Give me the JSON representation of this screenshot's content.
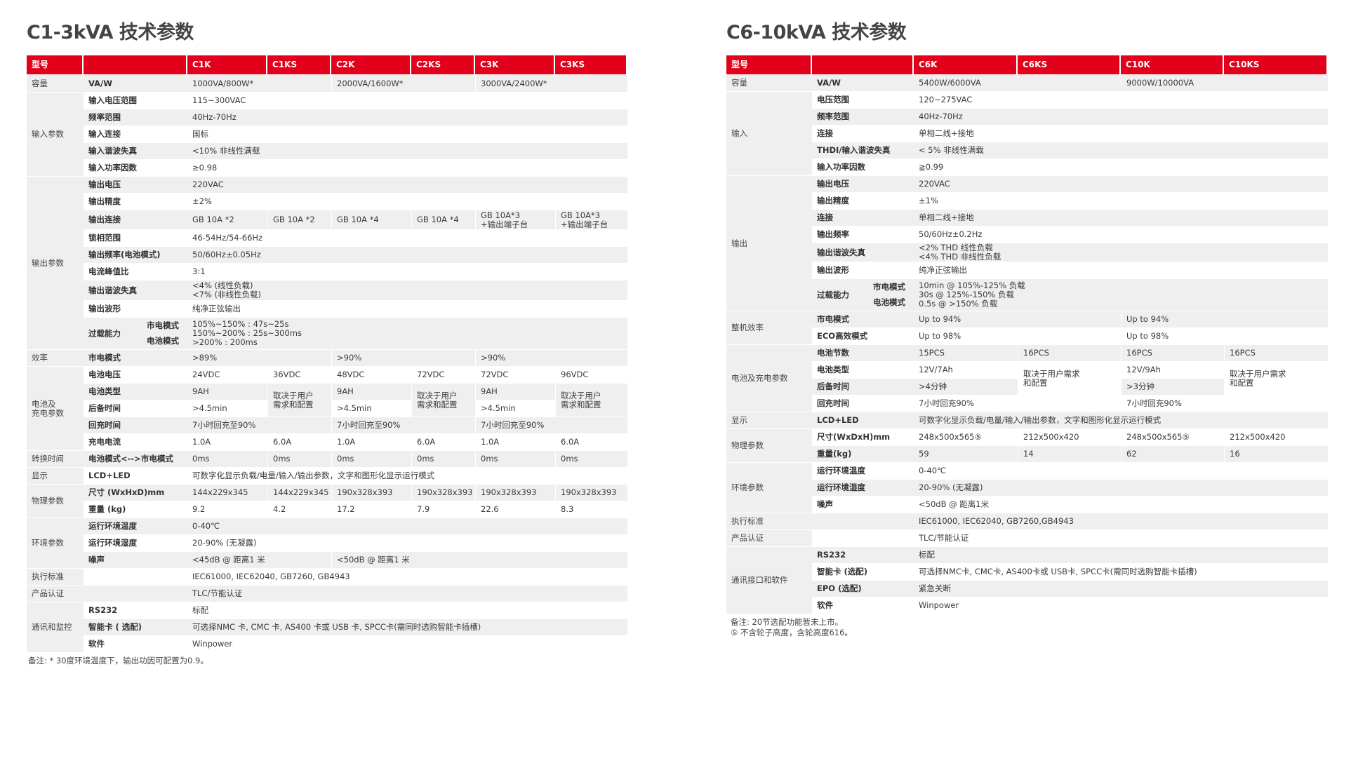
{
  "left": {
    "title": "C1-3kVA 技术参数",
    "header": [
      "型号",
      "",
      "C1K",
      "C1KS",
      "C2K",
      "C2KS",
      "C3K",
      "C3KS"
    ],
    "rows": [
      {
        "h": 24,
        "cat": "容量",
        "cat_span": 1,
        "param": "VA/W",
        "vals": [
          {
            "t": "1000VA/800W*",
            "s": 2
          },
          {
            "t": "2000VA/1600W*",
            "s": 2
          },
          {
            "t": "3000VA/2400W*",
            "s": 2
          }
        ]
      },
      {
        "h": 23,
        "cat": "输入参数",
        "cat_span": 5,
        "param": "输入电压范围",
        "vals": [
          {
            "t": "115~300VAC",
            "s": 6
          }
        ]
      },
      {
        "h": 23,
        "param": "频率范围",
        "vals": [
          {
            "t": "40Hz-70Hz",
            "s": 6
          }
        ]
      },
      {
        "h": 23,
        "param": "输入连接",
        "vals": [
          {
            "t": "国标",
            "s": 6
          }
        ]
      },
      {
        "h": 23,
        "param": "输入谐波失真",
        "vals": [
          {
            "t": "<10% 非线性满载",
            "s": 6
          }
        ]
      },
      {
        "h": 23,
        "param": "输入功率因数",
        "vals": [
          {
            "t": "≥0.98",
            "s": 6
          }
        ]
      },
      {
        "h": 23,
        "cat": "输出参数",
        "cat_span": 10,
        "param": "输出电压",
        "vals": [
          {
            "t": "220VAC",
            "s": 6
          }
        ]
      },
      {
        "h": 23,
        "param": "输出精度",
        "vals": [
          {
            "t": "±2%",
            "s": 6
          }
        ]
      },
      {
        "h": 27,
        "param": "输出连接",
        "vals": [
          {
            "t": "GB 10A *2",
            "s": 1
          },
          {
            "t": "GB 10A *2",
            "s": 1
          },
          {
            "t": "GB 10A *4",
            "s": 1
          },
          {
            "t": "GB 10A *4",
            "s": 1
          },
          {
            "t": "GB 10A*3\n+输出端子台",
            "s": 1
          },
          {
            "t": "GB 10A*3\n+输出端子台",
            "s": 1
          }
        ]
      },
      {
        "h": 23,
        "param": "锁相范围",
        "vals": [
          {
            "t": "46-54Hz/54-66Hz",
            "s": 6
          }
        ]
      },
      {
        "h": 23,
        "param": "输出频率(电池模式)",
        "vals": [
          {
            "t": "50/60Hz±0.05Hz",
            "s": 6
          }
        ]
      },
      {
        "h": 23,
        "param": "电流峰值比",
        "vals": [
          {
            "t": "3:1",
            "s": 6
          }
        ]
      },
      {
        "h": 28,
        "param": "输出谐波失真",
        "vals": [
          {
            "t": "<4% (线性负载)\n<7% (非线性负载)",
            "s": 6
          }
        ]
      },
      {
        "h": 23,
        "param": "输出波形",
        "vals": [
          {
            "t": "纯净正弦输出",
            "s": 6
          }
        ]
      },
      {
        "h": 22,
        "param": "过载能力",
        "param_span": 2,
        "sub": "市电模式",
        "vals": [
          {
            "t": "105%~150% : 47s~25s\n150%~200% : 25s~300ms\n>200% : 200ms",
            "s": 6,
            "r": 2
          }
        ]
      },
      {
        "h": 22,
        "sub": "电池模式",
        "vals": []
      },
      {
        "h": 23,
        "cat": "效率",
        "cat_span": 1,
        "param": "市电模式",
        "vals": [
          {
            "t": ">89%",
            "s": 2
          },
          {
            "t": ">90%",
            "s": 2
          },
          {
            "t": ">90%",
            "s": 2
          }
        ]
      },
      {
        "h": 23,
        "cat": "电池及\n充电参数",
        "cat_span": 5,
        "param": "电池电压",
        "vals": [
          {
            "t": "24VDC",
            "s": 1
          },
          {
            "t": "36VDC",
            "s": 1
          },
          {
            "t": "48VDC",
            "s": 1
          },
          {
            "t": "72VDC",
            "s": 1
          },
          {
            "t": "72VDC",
            "s": 1
          },
          {
            "t": "96VDC",
            "s": 1
          }
        ]
      },
      {
        "h": 23,
        "param": "电池类型",
        "vals": [
          {
            "t": "9AH",
            "s": 1
          },
          {
            "t": "取决于用户\n需求和配置",
            "s": 1,
            "r": 2
          },
          {
            "t": "9AH",
            "s": 1
          },
          {
            "t": "取决于用户\n需求和配置",
            "s": 1,
            "r": 2
          },
          {
            "t": "9AH",
            "s": 1
          },
          {
            "t": "取决于用户\n需求和配置",
            "s": 1,
            "r": 2
          }
        ]
      },
      {
        "h": 23,
        "param": "后备时间",
        "vals": [
          {
            "t": ">4.5min",
            "s": 1
          },
          {
            "t": ">4.5min",
            "s": 1
          },
          {
            "t": ">4.5min",
            "s": 1
          }
        ]
      },
      {
        "h": 23,
        "param": "回充时间",
        "vals": [
          {
            "t": "7小时回充至90%",
            "s": 2
          },
          {
            "t": "7小时回充至90%",
            "s": 2
          },
          {
            "t": "7小时回充至90%",
            "s": 2
          }
        ]
      },
      {
        "h": 23,
        "param": "充电电流",
        "vals": [
          {
            "t": "1.0A",
            "s": 1
          },
          {
            "t": "6.0A",
            "s": 1
          },
          {
            "t": "1.0A",
            "s": 1
          },
          {
            "t": "6.0A",
            "s": 1
          },
          {
            "t": "1.0A",
            "s": 1
          },
          {
            "t": "6.0A",
            "s": 1
          }
        ]
      },
      {
        "h": 23,
        "cat": "转换时间",
        "cat_span": 1,
        "param": "电池模式<-->市电模式",
        "vals": [
          {
            "t": "0ms",
            "s": 1
          },
          {
            "t": "0ms",
            "s": 1
          },
          {
            "t": "0ms",
            "s": 1
          },
          {
            "t": "0ms",
            "s": 1
          },
          {
            "t": "0ms",
            "s": 1
          },
          {
            "t": "0ms",
            "s": 1
          }
        ]
      },
      {
        "h": 23,
        "cat": "显示",
        "cat_span": 1,
        "param": "LCD+LED",
        "vals": [
          {
            "t": "可数字化显示负载/电量/输入/输出参数，文字和图形化显示运行模式",
            "s": 6
          }
        ]
      },
      {
        "h": 23,
        "cat": "物理参数",
        "cat_span": 2,
        "param": "尺寸 (WxHxD)mm",
        "vals": [
          {
            "t": "144x229x345",
            "s": 1
          },
          {
            "t": "144x229x345",
            "s": 1
          },
          {
            "t": "190x328x393",
            "s": 1
          },
          {
            "t": "190x328x393",
            "s": 1
          },
          {
            "t": "190x328x393",
            "s": 1
          },
          {
            "t": "190x328x393",
            "s": 1
          }
        ]
      },
      {
        "h": 23,
        "param": "重量 (kg)",
        "vals": [
          {
            "t": "9.2",
            "s": 1
          },
          {
            "t": "4.2",
            "s": 1
          },
          {
            "t": "17.2",
            "s": 1
          },
          {
            "t": "7.9",
            "s": 1
          },
          {
            "t": "22.6",
            "s": 1
          },
          {
            "t": "8.3",
            "s": 1
          }
        ]
      },
      {
        "h": 23,
        "cat": "环境参数",
        "cat_span": 3,
        "param": "运行环境温度",
        "vals": [
          {
            "t": "0-40℃",
            "s": 6
          }
        ]
      },
      {
        "h": 23,
        "param": "运行环境湿度",
        "vals": [
          {
            "t": "20-90% (无凝露)",
            "s": 6
          }
        ]
      },
      {
        "h": 23,
        "param": "噪声",
        "vals": [
          {
            "t": "<45dB @ 距离1 米",
            "s": 2
          },
          {
            "t": "<50dB @ 距离1 米",
            "s": 4
          }
        ]
      },
      {
        "h": 23,
        "cat": "执行标准",
        "cat_span": 1,
        "param": "",
        "vals": [
          {
            "t": "IEC61000, IEC62040, GB7260, GB4943",
            "s": 6
          }
        ]
      },
      {
        "h": 23,
        "cat": "产品认证",
        "cat_span": 1,
        "param": "",
        "vals": [
          {
            "t": "TLC/节能认证",
            "s": 6
          }
        ]
      },
      {
        "h": 23,
        "cat": "通讯和监控",
        "cat_span": 3,
        "param": "RS232",
        "vals": [
          {
            "t": "标配",
            "s": 6
          }
        ]
      },
      {
        "h": 23,
        "param": "智能卡 ( 选配)",
        "vals": [
          {
            "t": "可选择NMC 卡, CMC 卡, AS400 卡或 USB 卡, SPCC卡(需同时选购智能卡插槽)",
            "s": 6
          }
        ]
      },
      {
        "h": 23,
        "param": "软件",
        "vals": [
          {
            "t": "Winpower",
            "s": 6
          }
        ]
      }
    ],
    "note": "备注: * 30度环境温度下，输出功因可配置为0.9。"
  },
  "right": {
    "title": "C6-10kVA 技术参数",
    "header": [
      "型号",
      "",
      "C6K",
      "C6KS",
      "C10K",
      "C10KS"
    ],
    "rows": [
      {
        "h": 23,
        "cat": "容量",
        "cat_span": 1,
        "param": "VA/W",
        "vals": [
          {
            "t": "5400W/6000VA",
            "s": 2
          },
          {
            "t": "9000W/10000VA",
            "s": 2
          }
        ]
      },
      {
        "h": 23,
        "cat": "输入",
        "cat_span": 5,
        "param": "电压范围",
        "vals": [
          {
            "t": "120~275VAC",
            "s": 4
          }
        ]
      },
      {
        "h": 23,
        "param": "频率范围",
        "vals": [
          {
            "t": "40Hz-70Hz",
            "s": 4
          }
        ]
      },
      {
        "h": 23,
        "param": "连接",
        "vals": [
          {
            "t": "单相二线+接地",
            "s": 4
          }
        ]
      },
      {
        "h": 23,
        "param": "THDI/输入谐波失真",
        "vals": [
          {
            "t": "< 5% 非线性满载",
            "s": 4
          }
        ]
      },
      {
        "h": 23,
        "param": "输入功率因数",
        "vals": [
          {
            "t": "≧0.99",
            "s": 4
          }
        ]
      },
      {
        "h": 23,
        "cat": "输出",
        "cat_span": 8,
        "param": "输出电压",
        "vals": [
          {
            "t": "220VAC",
            "s": 4
          }
        ]
      },
      {
        "h": 23,
        "param": "输出精度",
        "vals": [
          {
            "t": "±1%",
            "s": 4
          }
        ]
      },
      {
        "h": 23,
        "param": "连接",
        "vals": [
          {
            "t": "单相二线+接地",
            "s": 4
          }
        ]
      },
      {
        "h": 23,
        "param": "输出频率",
        "vals": [
          {
            "t": "50/60Hz±0.2Hz",
            "s": 4
          }
        ]
      },
      {
        "h": 23,
        "param": "输出谐波失真",
        "vals": [
          {
            "t": "<2% THD 线性负载\n<4% THD 非线性负载",
            "s": 4
          }
        ]
      },
      {
        "h": 23,
        "param": "输出波形",
        "vals": [
          {
            "t": "纯净正弦输出",
            "s": 4
          }
        ]
      },
      {
        "h": 22,
        "param": "过载能力",
        "param_span": 2,
        "sub": "市电模式",
        "vals": [
          {
            "t": "10min @ 105%-125% 负载\n30s @ 125%-150% 负载\n0.5s @ >150% 负载",
            "s": 4,
            "r": 2
          }
        ]
      },
      {
        "h": 22,
        "sub": "电池模式",
        "vals": []
      },
      {
        "h": 23,
        "cat": "整机效率",
        "cat_span": 2,
        "param": "市电模式",
        "vals": [
          {
            "t": "Up to 94%",
            "s": 2
          },
          {
            "t": "Up to 94%",
            "s": 2
          }
        ]
      },
      {
        "h": 23,
        "param": "ECO高效模式",
        "vals": [
          {
            "t": "Up to 98%",
            "s": 2
          },
          {
            "t": "Up to 98%",
            "s": 2
          }
        ]
      },
      {
        "h": 23,
        "cat": "电池及充电参数",
        "cat_span": 4,
        "param": "电池节数",
        "vals": [
          {
            "t": "15PCS",
            "s": 1
          },
          {
            "t": "16PCS",
            "s": 1
          },
          {
            "t": "16PCS",
            "s": 1
          },
          {
            "t": "16PCS",
            "s": 1
          }
        ]
      },
      {
        "h": 23,
        "param": "电池类型",
        "vals": [
          {
            "t": "12V/7Ah",
            "s": 1
          },
          {
            "t": "取决于用户需求\n和配置",
            "s": 1,
            "r": 2
          },
          {
            "t": "12V/9Ah",
            "s": 1
          },
          {
            "t": "取决于用户需求\n和配置",
            "s": 1,
            "r": 2
          }
        ]
      },
      {
        "h": 23,
        "param": "后备时间",
        "vals": [
          {
            "t": ">4分钟",
            "s": 1
          },
          {
            "t": ">3分钟",
            "s": 1
          }
        ]
      },
      {
        "h": 23,
        "param": "回充时间",
        "vals": [
          {
            "t": "7小时回充90%",
            "s": 2
          },
          {
            "t": "7小时回充90%",
            "s": 2
          }
        ]
      },
      {
        "h": 23,
        "cat": "显示",
        "cat_span": 1,
        "param": "LCD+LED",
        "vals": [
          {
            "t": "可数字化显示负载/电量/输入/输出参数，文字和图形化显示运行模式",
            "s": 4
          }
        ]
      },
      {
        "h": 23,
        "cat": "物理参数",
        "cat_span": 2,
        "param": "尺寸(WxDxH)mm",
        "vals": [
          {
            "t": "248x500x565⑤",
            "s": 1
          },
          {
            "t": "212x500x420",
            "s": 1
          },
          {
            "t": "248x500x565⑤",
            "s": 1
          },
          {
            "t": "212x500x420",
            "s": 1
          }
        ]
      },
      {
        "h": 23,
        "param": "重量(kg)",
        "vals": [
          {
            "t": "59",
            "s": 1
          },
          {
            "t": "14",
            "s": 1
          },
          {
            "t": "62",
            "s": 1
          },
          {
            "t": "16",
            "s": 1
          }
        ]
      },
      {
        "h": 23,
        "cat": "环境参数",
        "cat_span": 3,
        "param": "运行环境温度",
        "vals": [
          {
            "t": "0-40℃",
            "s": 4
          }
        ]
      },
      {
        "h": 23,
        "param": "运行环境湿度",
        "vals": [
          {
            "t": "20-90% (无凝露)",
            "s": 4
          }
        ]
      },
      {
        "h": 23,
        "param": "噪声",
        "vals": [
          {
            "t": "<50dB @ 距离1米",
            "s": 4
          }
        ]
      },
      {
        "h": 23,
        "cat": "执行标准",
        "cat_span": 1,
        "param": "",
        "vals": [
          {
            "t": "IEC61000, IEC62040, GB7260,GB4943",
            "s": 4
          }
        ]
      },
      {
        "h": 23,
        "cat": "产品认证",
        "cat_span": 1,
        "param": "",
        "vals": [
          {
            "t": "TLC/节能认证",
            "s": 4
          }
        ]
      },
      {
        "h": 23,
        "cat": "通讯接口和软件",
        "cat_span": 4,
        "param": "RS232",
        "vals": [
          {
            "t": "标配",
            "s": 4
          }
        ]
      },
      {
        "h": 23,
        "param": "智能卡 (选配)",
        "vals": [
          {
            "t": "可选择NMC卡, CMC卡, AS400卡或 USB卡, SPCC卡(需同时选购智能卡插槽)",
            "s": 4
          }
        ]
      },
      {
        "h": 23,
        "param": "EPO (选配)",
        "vals": [
          {
            "t": "紧急关断",
            "s": 4
          }
        ]
      },
      {
        "h": 23,
        "param": "软件",
        "vals": [
          {
            "t": "Winpower",
            "s": 4
          }
        ]
      }
    ],
    "note": "备注: 20节选配功能暂未上市。\n        ⑤ 不含轮子高度，含轮高度616。"
  }
}
